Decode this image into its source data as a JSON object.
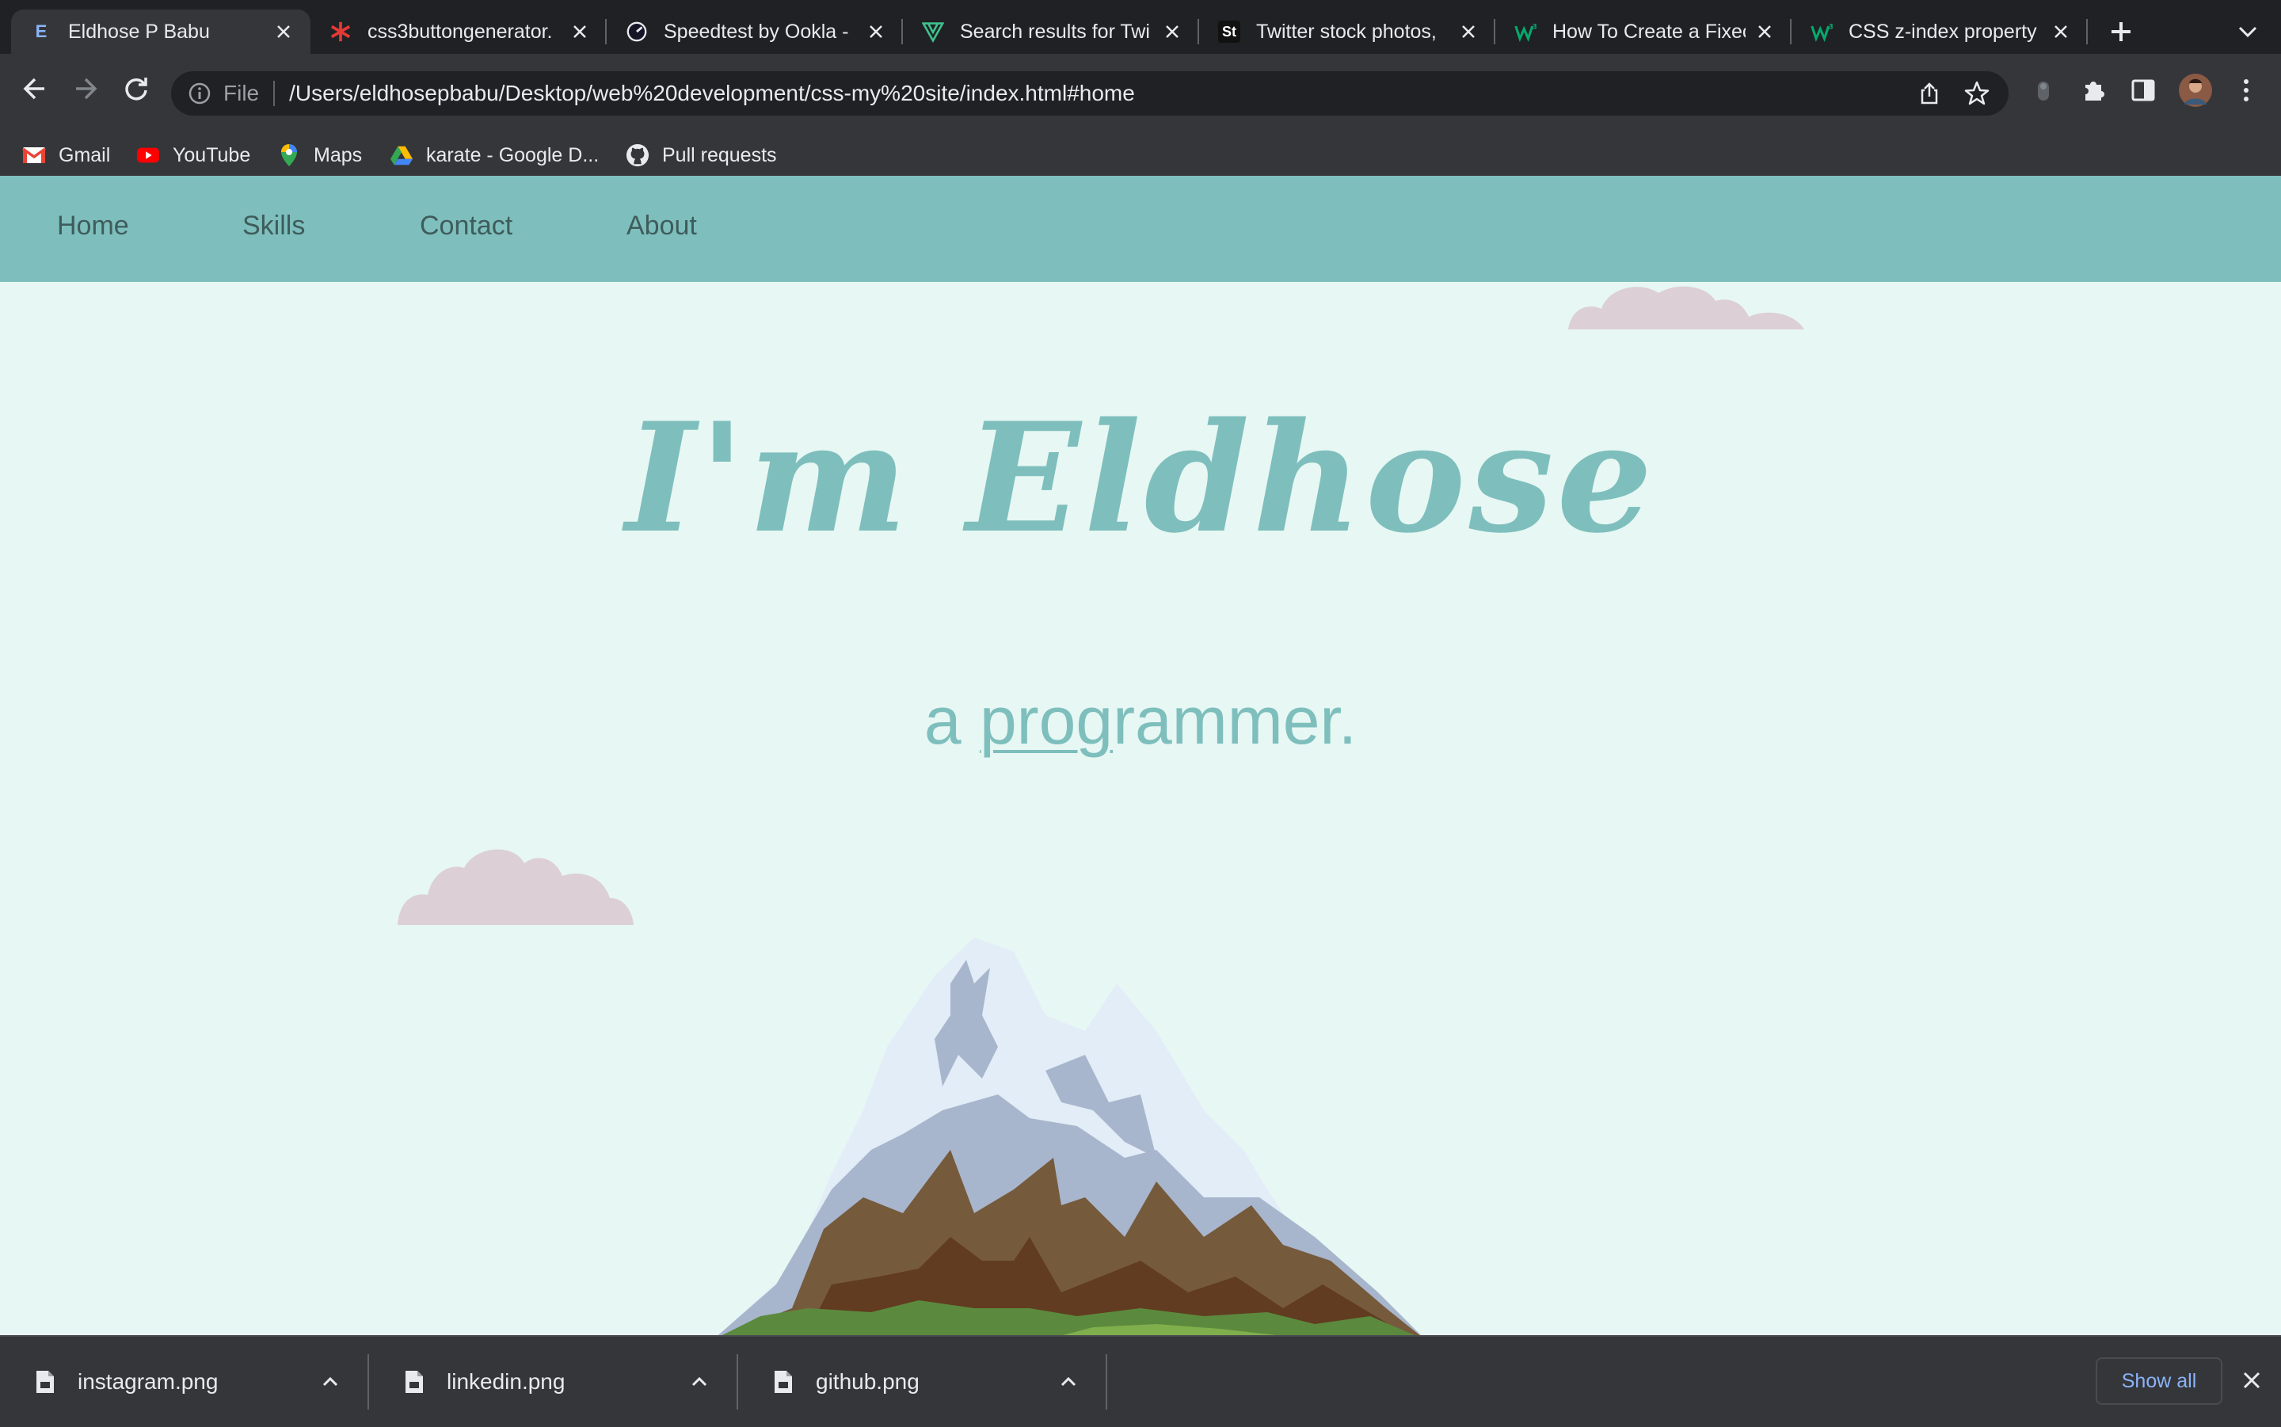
{
  "browser": {
    "tabs": [
      {
        "favicon": "E",
        "title": "Eldhose P Babu",
        "active": true
      },
      {
        "favicon": "asterisk-icon",
        "title": "css3buttongenerator.",
        "active": false
      },
      {
        "favicon": "speedtest-icon",
        "title": "Speedtest by Ookla -",
        "active": false
      },
      {
        "favicon": "vuetify-icon",
        "title": "Search results for Twi",
        "active": false
      },
      {
        "favicon": "St",
        "title": "Twitter stock photos,",
        "active": false
      },
      {
        "favicon": "w3-icon",
        "title": "How To Create a Fixec",
        "active": false
      },
      {
        "favicon": "w3-icon",
        "title": "CSS z-index property",
        "active": false
      }
    ],
    "omnibox": {
      "scheme": "File",
      "url": "/Users/eldhosepbabu/Desktop/web%20development/css-my%20site/index.html#home"
    },
    "bookmarks": [
      {
        "label": "Gmail",
        "icon": "gmail-icon"
      },
      {
        "label": "YouTube",
        "icon": "youtube-icon"
      },
      {
        "label": "Maps",
        "icon": "maps-icon"
      },
      {
        "label": "karate - Google D...",
        "icon": "drive-icon"
      },
      {
        "label": "Pull requests",
        "icon": "github-icon"
      }
    ]
  },
  "site": {
    "nav": [
      "Home",
      "Skills",
      "Contact",
      "About"
    ],
    "title": "I'm Eldhose",
    "subtitle_prefix": "a ",
    "subtitle_underlined": "prog",
    "subtitle_rest": "rammer."
  },
  "downloads": {
    "items": [
      "instagram.png",
      "linkedin.png",
      "github.png"
    ],
    "show_all": "Show all"
  },
  "colors": {
    "nav_bg": "#7ebfbd",
    "page_bg": "#e7f7f3",
    "accent": "#7ebfbd",
    "cloud": "#dccfd6"
  }
}
